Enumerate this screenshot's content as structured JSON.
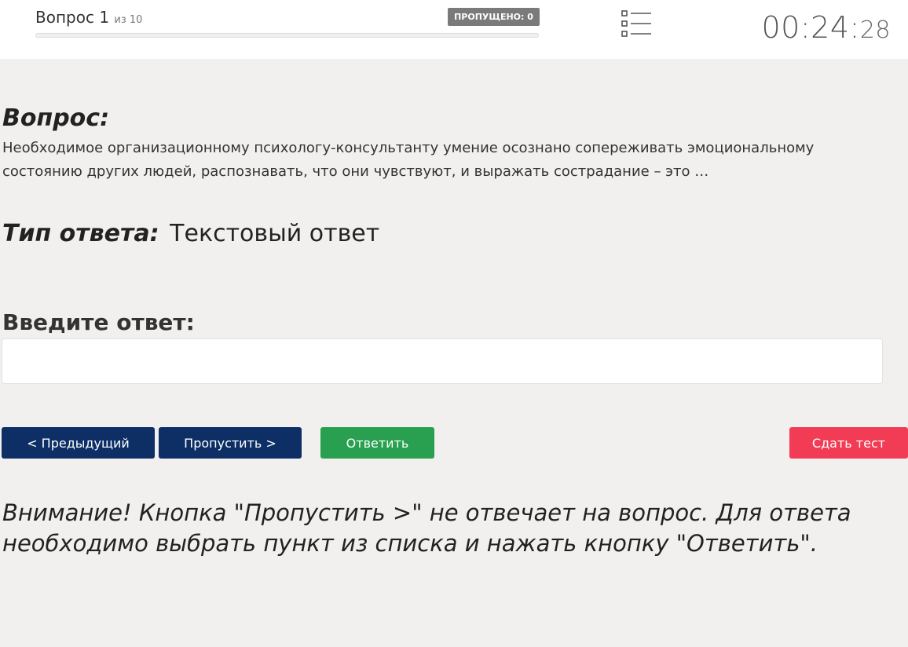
{
  "header": {
    "question_label": "Вопрос 1",
    "question_total": "из 10",
    "progress": 0,
    "skipped_badge": "ПРОПУЩЕНО: 0",
    "list_icon": "list-icon",
    "timer_main": "00:24:",
    "timer_seconds": "28"
  },
  "question": {
    "label": "Вопрос:",
    "text": "Необходимое организационному психологу-консультанту умение осознано сопереживать эмоциональному состоянию других людей, распознавать, что они чувствуют, и выражать сострадание – это …"
  },
  "answer_type": {
    "label": "Тип ответа:",
    "value": "Текстовый ответ"
  },
  "answer": {
    "label": "Введите ответ:",
    "value": "",
    "placeholder": ""
  },
  "buttons": {
    "prev": "< Предыдущий",
    "skip": "Пропустить >",
    "answer": "Ответить",
    "submit": "Сдать тест"
  },
  "warning": "Внимание! Кнопка \"Пропустить >\" не отвечает на вопрос. Для ответа необходимо выбрать пункт из списка и нажать кнопку \"Ответить\".",
  "colors": {
    "primary": "#0d2f66",
    "success": "#28a04f",
    "danger": "#f23c55",
    "badge": "#7a7a7a",
    "background": "#f1f0ee"
  }
}
